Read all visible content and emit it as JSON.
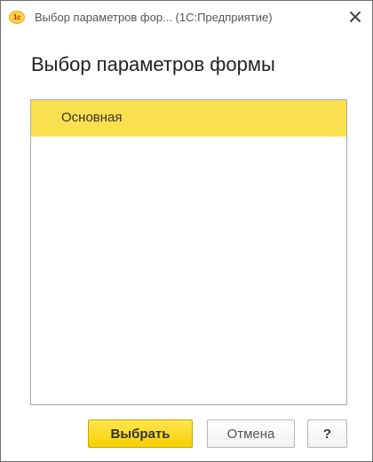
{
  "window": {
    "title": "Выбор параметров фор...  (1С:Предприятие)",
    "logo_text": "1с",
    "close_glyph": "✕"
  },
  "form": {
    "title": "Выбор параметров формы"
  },
  "list": {
    "items": [
      {
        "label": "Основная",
        "selected": true
      }
    ]
  },
  "buttons": {
    "select_label": "Выбрать",
    "cancel_label": "Отмена",
    "help_label": "?"
  },
  "colors": {
    "selection": "#fae04f",
    "primary_button": "#f6d000",
    "border": "#a9a9a9"
  }
}
